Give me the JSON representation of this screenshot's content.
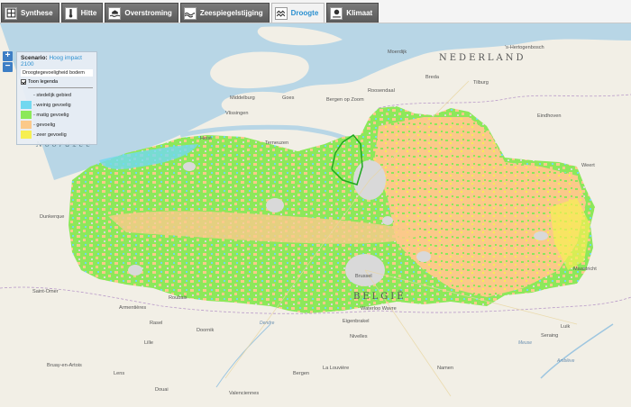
{
  "tabs": [
    {
      "label": "Synthese",
      "icon": "synthese-icon",
      "active": false
    },
    {
      "label": "Hitte",
      "icon": "thermometer-icon",
      "active": false
    },
    {
      "label": "Overstroming",
      "icon": "flood-icon",
      "active": false
    },
    {
      "label": "Zeespiegelstijging",
      "icon": "sea-level-icon",
      "active": false
    },
    {
      "label": "Droogte",
      "icon": "drought-icon",
      "active": true
    },
    {
      "label": "Klimaat",
      "icon": "climate-icon",
      "active": false
    }
  ],
  "zoom": {
    "in": "+",
    "out": "−"
  },
  "legend": {
    "scenario_label": "Scenario:",
    "scenario_value": "Hoog impact 2100",
    "layer": "Droogtegevoeligheid bodem",
    "toggle": "Toon legenda",
    "items": [
      {
        "label": "- stedelijk gebied",
        "color": "#d9d9d9"
      },
      {
        "label": "- weinig gevoelig",
        "color": "#72d8f0"
      },
      {
        "label": "- matig gevoelig",
        "color": "#8ce85a"
      },
      {
        "label": "- gevoelig",
        "color": "#fbc98a"
      },
      {
        "label": "- zeer gevoelig",
        "color": "#f6ef52"
      }
    ]
  },
  "map_labels": {
    "country_nl": "NEDERLAND",
    "country_be": "BELGIË",
    "sea": "Noordzee",
    "hertogenbosch": "'s-Hertogenbosch",
    "moerdijk": "Moerdijk",
    "breda": "Breda",
    "tilburg": "Tilburg",
    "eindhoven": "Eindhoven",
    "middelburg": "Middelburg",
    "goes": "Goes",
    "bergen": "Bergen op Zoom",
    "roosendaal": "Roosendaal",
    "vlissingen": "Vlissingen",
    "terneuzen": "Terneuzen",
    "heist": "Heist",
    "weert": "Weert",
    "dunkerque": "Dunkerque",
    "saint_omer": "Saint-Omer",
    "armentieres": "Armentières",
    "roubaix": "Roubaix",
    "rasel": "Rasel",
    "lille": "Lille",
    "douai": "Douai",
    "lens": "Lens",
    "bruay": "Bruay-en-Artois",
    "valenciennes": "Valenciennes",
    "la_louviere": "La Louvière",
    "bergen_be": "Bergen",
    "namen": "Namen",
    "nivelles": "Nivelles",
    "waterloo": "Waterloo Wavre",
    "eigenbrakel": "Eigenbrakel",
    "brussel": "Brussel",
    "maastricht": "Maastricht",
    "luik": "Luik",
    "seraing": "Seraing",
    "doornik": "Doornik",
    "meuse": "Meuse",
    "amblève": "Amblève",
    "dendre": "Dendre"
  },
  "colors": {
    "urban": "#d9d9d9",
    "low": "#72d8f0",
    "medium": "#8ce85a",
    "sensitive": "#fbc98a",
    "very": "#f6ef52",
    "sea": "#b8d6e6",
    "land": "#f2efe6",
    "highlight": "#1fa81f"
  }
}
